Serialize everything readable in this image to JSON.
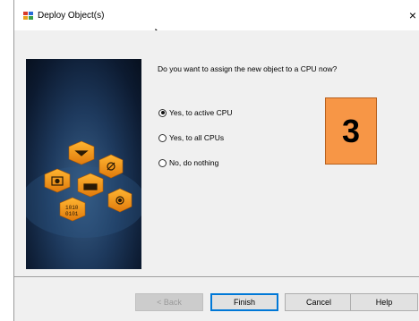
{
  "window": {
    "title": "Deploy Object(s)",
    "close_glyph": "×"
  },
  "icons": [
    "app-icon",
    "mouse-cursor-icon",
    "banner-graphic"
  ],
  "main": {
    "question": "Do you want to assign the new object to a CPU now?",
    "options": [
      {
        "label": "Yes, to active CPU",
        "selected": true
      },
      {
        "label": "Yes, to all CPUs",
        "selected": false
      },
      {
        "label": "No, do nothing",
        "selected": false
      }
    ]
  },
  "annotation": {
    "step_number": "3",
    "color": "#f79646"
  },
  "buttons": {
    "back": "< Back",
    "finish": "Finish",
    "cancel": "Cancel",
    "help": "Help"
  },
  "colors": {
    "banner_dark": "#0c1a30",
    "hex_orange": "#f39c1f",
    "focus_blue": "#0078d7"
  }
}
